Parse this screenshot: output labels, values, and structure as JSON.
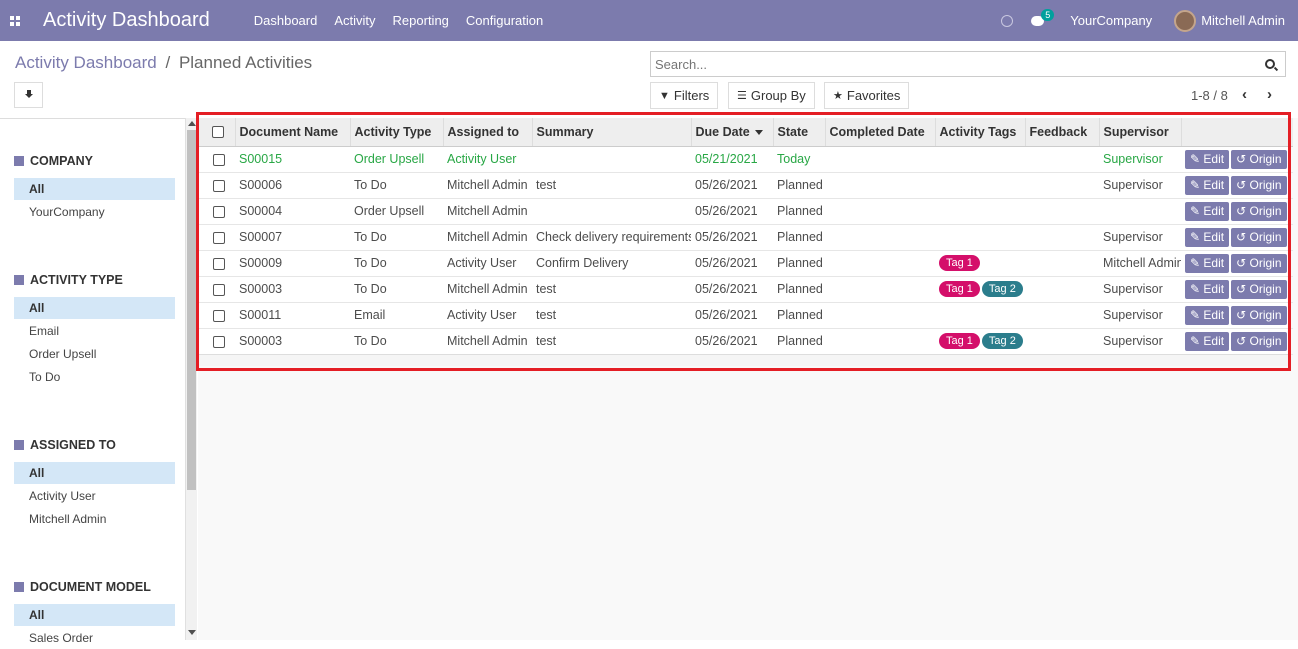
{
  "navbar": {
    "title": "Activity Dashboard",
    "menu": [
      "Dashboard",
      "Activity",
      "Reporting",
      "Configuration"
    ],
    "messages_count": "5",
    "company": "YourCompany",
    "user": "Mitchell Admin",
    "bar_color": "#7c7bad"
  },
  "breadcrumb": {
    "parent": "Activity Dashboard",
    "separator": "/",
    "current": "Planned Activities"
  },
  "search": {
    "placeholder": "Search..."
  },
  "controls": {
    "filters": "Filters",
    "group_by": "Group By",
    "favorites": "Favorites"
  },
  "pager": {
    "value": "1-8 / 8"
  },
  "sidebar": {
    "company": {
      "title": "COMPANY",
      "items": [
        "All",
        "YourCompany"
      ]
    },
    "activity_type": {
      "title": "ACTIVITY TYPE",
      "items": [
        "All",
        "Email",
        "Order Upsell",
        "To Do"
      ]
    },
    "assigned_to": {
      "title": "ASSIGNED TO",
      "items": [
        "All",
        "Activity User",
        "Mitchell Admin"
      ]
    },
    "document_model": {
      "title": "DOCUMENT MODEL",
      "items": [
        "All",
        "Sales Order"
      ]
    }
  },
  "table": {
    "columns": [
      "Document Name",
      "Activity Type",
      "Assigned to",
      "Summary",
      "Due Date",
      "State",
      "Completed Date",
      "Activity Tags",
      "Feedback",
      "Supervisor"
    ],
    "edit_label": "Edit",
    "origin_label": "Origin",
    "rows": [
      {
        "doc": "S00015",
        "type": "Order Upsell",
        "assigned": "Activity User",
        "summary": "",
        "due": "05/21/2021",
        "state": "Today",
        "completed": "",
        "tags": [],
        "feedback": "",
        "supervisor": "Supervisor",
        "highlight": true
      },
      {
        "doc": "S00006",
        "type": "To Do",
        "assigned": "Mitchell Admin",
        "summary": "test",
        "due": "05/26/2021",
        "state": "Planned",
        "completed": "",
        "tags": [],
        "feedback": "",
        "supervisor": "Supervisor"
      },
      {
        "doc": "S00004",
        "type": "Order Upsell",
        "assigned": "Mitchell Admin",
        "summary": "",
        "due": "05/26/2021",
        "state": "Planned",
        "completed": "",
        "tags": [],
        "feedback": "",
        "supervisor": ""
      },
      {
        "doc": "S00007",
        "type": "To Do",
        "assigned": "Mitchell Admin",
        "summary": "Check delivery requirements",
        "due": "05/26/2021",
        "state": "Planned",
        "completed": "",
        "tags": [],
        "feedback": "",
        "supervisor": "Supervisor"
      },
      {
        "doc": "S00009",
        "type": "To Do",
        "assigned": "Activity User",
        "summary": "Confirm Delivery",
        "due": "05/26/2021",
        "state": "Planned",
        "completed": "",
        "tags": [
          "Tag 1"
        ],
        "feedback": "",
        "supervisor": "Mitchell Admin"
      },
      {
        "doc": "S00003",
        "type": "To Do",
        "assigned": "Mitchell Admin",
        "summary": "test",
        "due": "05/26/2021",
        "state": "Planned",
        "completed": "",
        "tags": [
          "Tag 1",
          "Tag 2"
        ],
        "feedback": "",
        "supervisor": "Supervisor"
      },
      {
        "doc": "S00011",
        "type": "Email",
        "assigned": "Activity User",
        "summary": "test",
        "due": "05/26/2021",
        "state": "Planned",
        "completed": "",
        "tags": [],
        "feedback": "",
        "supervisor": "Supervisor"
      },
      {
        "doc": "S00003",
        "type": "To Do",
        "assigned": "Mitchell Admin",
        "summary": "test",
        "due": "05/26/2021",
        "state": "Planned",
        "completed": "",
        "tags": [
          "Tag 1",
          "Tag 2"
        ],
        "feedback": "",
        "supervisor": "Supervisor"
      }
    ]
  },
  "colors": {
    "tag_1": "#d40f6a",
    "tag_2": "#2b7d8c",
    "today": "#28a745",
    "highlight_frame": "#e41e25"
  }
}
